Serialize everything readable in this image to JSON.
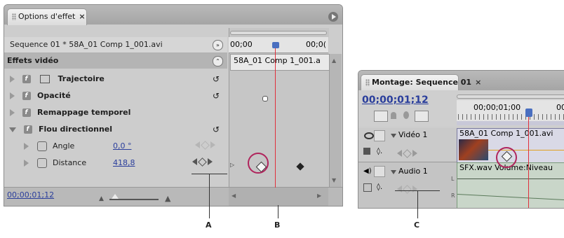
{
  "effect_panel": {
    "tab_label": "Options d'effet",
    "tab_close": "×",
    "sequence_label": "Sequence 01 * 58A_01 Comp 1_001.avi",
    "timecode_start": "00;00",
    "timecode_end": "00;0(",
    "clip_label": "58A_01 Comp 1_001.a",
    "section_title": "Effets vidéo",
    "effects": [
      {
        "label": "Trajectoire"
      },
      {
        "label": "Opacité"
      },
      {
        "label": "Remappage temporel"
      },
      {
        "label": "Flou directionnel"
      }
    ],
    "params": [
      {
        "label": "Angle",
        "value": "0,0 °"
      },
      {
        "label": "Distance",
        "value": "418,8"
      }
    ],
    "footer_timecode": "00;00;01;12"
  },
  "timeline_panel": {
    "tab_label": "Montage: Sequence 01",
    "tab_close": "×",
    "timecode": "00;00;01;12",
    "ruler_label": "00;00;01;00",
    "ruler_label_2": "00",
    "video_track": "Vidéo 1",
    "video_clip": "58A_01 Comp 1_001.avi",
    "audio_track": "Audio 1",
    "audio_clip": "SFX.wav",
    "audio_volume": "Volume:Niveau",
    "audio_L": "L",
    "audio_R": "R"
  },
  "callouts": {
    "a": "A",
    "b": "B",
    "c": "C"
  },
  "colors": {
    "playhead": "#e0303c",
    "callout_circle": "#b0245c",
    "accent_blue": "#2a3e9c"
  }
}
